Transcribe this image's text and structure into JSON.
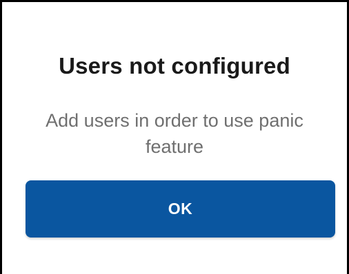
{
  "dialog": {
    "title": "Users not configured",
    "message": "Add users in order to use panic feature",
    "ok_label": "OK"
  },
  "colors": {
    "button_background": "#0a56a0",
    "button_text": "#ffffff",
    "title_text": "#1a1a1a",
    "message_text": "#6f6f6f",
    "background": "#ffffff"
  }
}
